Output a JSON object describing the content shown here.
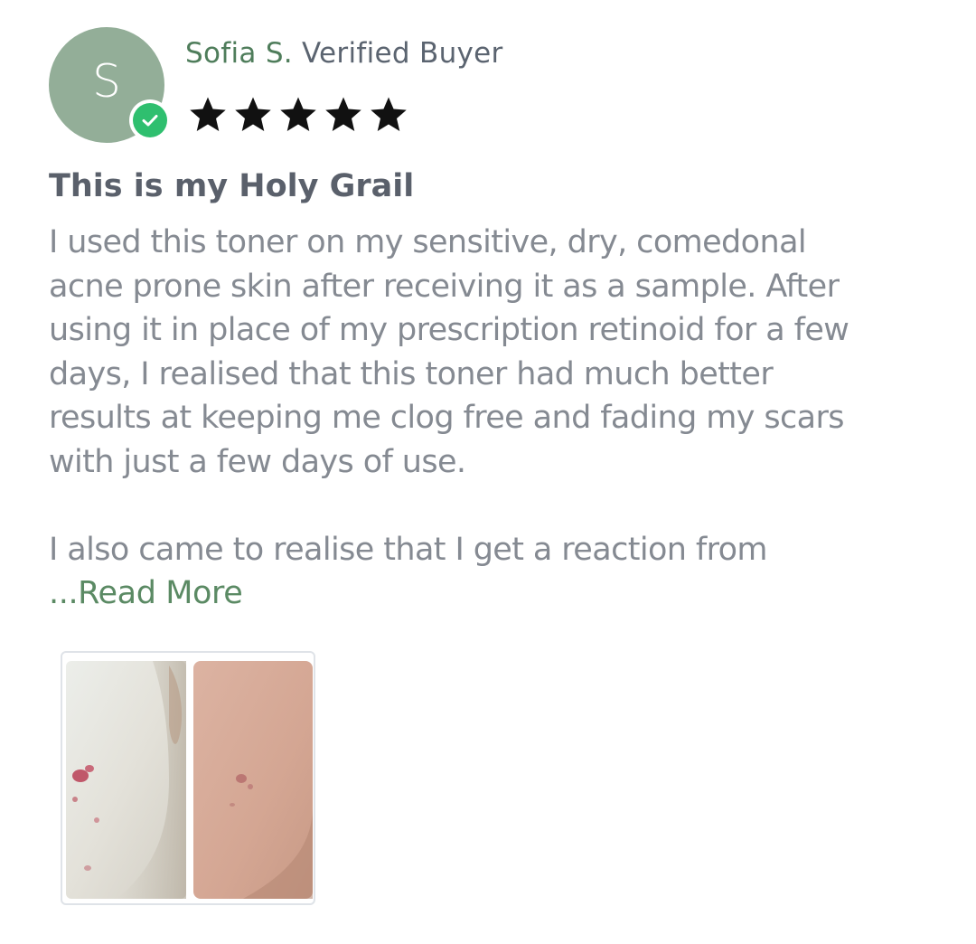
{
  "review": {
    "author": {
      "initial": "S",
      "name": "Sofia S.",
      "verified_label": "Verified Buyer",
      "avatar_color": "#93ae98",
      "badge_color": "#2fbf6f",
      "badge_icon": "check-circle-icon"
    },
    "rating": {
      "stars": 5,
      "max": 5,
      "star_color": "#111111",
      "star_icon": "star-icon"
    },
    "title": "This is my Holy Grail",
    "body_lines": [
      "I used this toner on my sensitive, dry, comedonal",
      "acne prone skin after receiving it as a sample. After",
      "using it in place of my prescription retinoid for a few",
      "days, I realised that this toner had much better",
      "results at keeping me clog free and fading my scars",
      "with just a few days of use.",
      "",
      "I also came to realise that I get a reaction from"
    ],
    "read_more_label": "...Read More",
    "colors": {
      "name": "#4f7d5b",
      "meta": "#5b6470",
      "title": "#5a606b",
      "body": "#858a92",
      "link": "#5b8a64"
    },
    "photo": {
      "description_icon": "before-after-photo"
    }
  }
}
